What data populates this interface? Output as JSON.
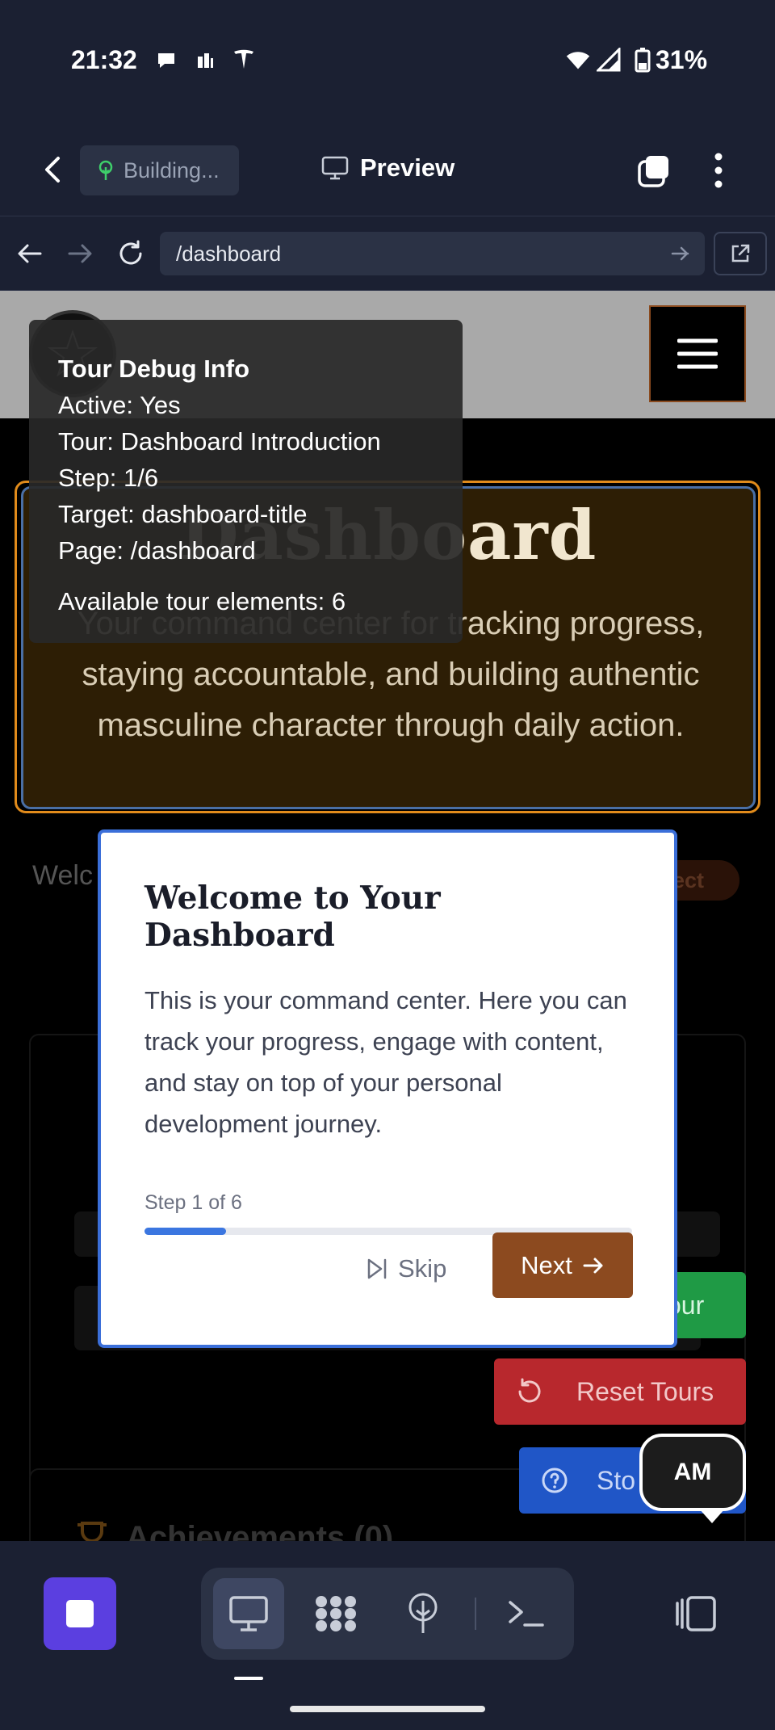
{
  "status_bar": {
    "time": "21:32",
    "battery": "31%"
  },
  "header": {
    "building_label": "Building...",
    "preview_label": "Preview"
  },
  "url_bar": {
    "path": "/dashboard"
  },
  "page": {
    "hero_title": "Dashboard",
    "hero_subtitle": "Your command center for tracking progress, staying accountable, and building authentic masculine character through daily action.",
    "welcome_partial": "Welc",
    "tag_partial": "tect",
    "achievements_title": "Achievements (0)",
    "start_tour_partial": "our",
    "reset_tours": "Reset Tours",
    "stop_partial": "Sto",
    "avatar_initials": "AM"
  },
  "debug": {
    "title": "Tour Debug Info",
    "active": "Active: Yes",
    "tour": "Tour: Dashboard Introduction",
    "step": "Step: 1/6",
    "target": "Target: dashboard-title",
    "page": "Page: /dashboard",
    "elements": "Available tour elements: 6"
  },
  "modal": {
    "title": "Welcome to Your Dashboard",
    "body": "This is your command center. Here you can track your progress, engage with content, and stay on top of your personal development journey.",
    "step_label": "Step 1 of 6",
    "progress": 0.167,
    "skip_label": "Skip",
    "next_label": "Next"
  },
  "colors": {
    "accent": "#8c4a1f",
    "progress": "#3b76e0",
    "highlight": "#e18b1b"
  }
}
